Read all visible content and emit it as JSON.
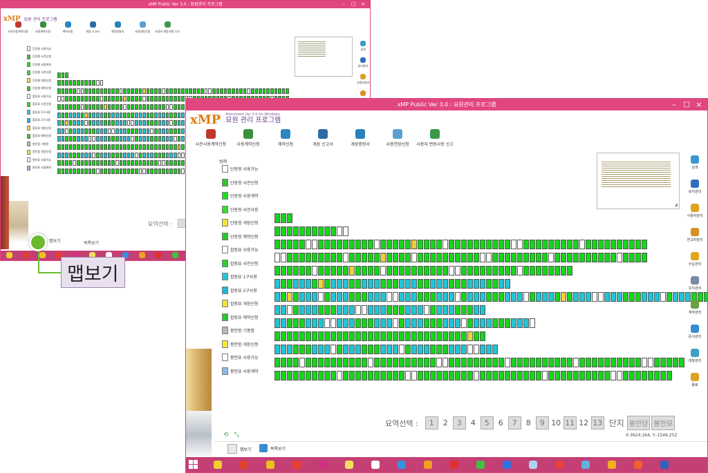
{
  "window": {
    "title": "xMP Public Ver 3.0 : 묘원관리 프로그램",
    "brand_mark": "xMP",
    "brand_tag": "Monument Ver 3.0 for Windows",
    "brand_sub": "묘원 관리 프로그램"
  },
  "toolbar": [
    {
      "label": "사전사용계약신청",
      "icon": "calendar-icon",
      "color": "#c0392b"
    },
    {
      "label": "사용계약신청",
      "icon": "contract-icon",
      "color": "#3a8f3a"
    },
    {
      "label": "해약신청",
      "icon": "cube-icon",
      "color": "#2e86c1"
    },
    {
      "label": "개장 신고서",
      "icon": "monitor-icon",
      "color": "#2e6da4"
    },
    {
      "label": "개장명령서",
      "icon": "book-icon",
      "color": "#2a80b9"
    },
    {
      "label": "사용연장신청",
      "icon": "papers-icon",
      "color": "#5aa0d0"
    },
    {
      "label": "사용자 변동사항 신고",
      "icon": "globe-icon",
      "color": "#3a9a4a"
    }
  ],
  "legend": {
    "title": "범례",
    "items": [
      {
        "label": "단장형 사용가능",
        "color": "#ffffff"
      },
      {
        "label": "단장형 사전신청",
        "color": "#34c334"
      },
      {
        "label": "단장형 사용계약",
        "color": "#19e019"
      },
      {
        "label": "단장형 사전사용",
        "color": "#33dd33"
      },
      {
        "label": "단장형 개장신청",
        "color": "#f5e33b"
      },
      {
        "label": "단장형 해약신청",
        "color": "#25cc25"
      },
      {
        "label": "합장묘 사용가능",
        "color": "#ffffff"
      },
      {
        "label": "합장묘 사전신청",
        "color": "#2fcf2f"
      },
      {
        "label": "합장묘 1구사용",
        "color": "#28c8d8"
      },
      {
        "label": "합장묘 2구사용",
        "color": "#1fbad0"
      },
      {
        "label": "합장묘 개장신청",
        "color": "#f0e040"
      },
      {
        "label": "합장묘 해약신청",
        "color": "#2ac82a"
      },
      {
        "label": "봉안함 기봉함",
        "color": "#b8b8b8"
      },
      {
        "label": "봉안함 개장신청",
        "color": "#f4e83c"
      },
      {
        "label": "봉안묘 사용가능",
        "color": "#ffffff"
      },
      {
        "label": "봉안묘 사용계약",
        "color": "#8fb8e8"
      }
    ]
  },
  "rows": [
    {
      "green": 0,
      "count": 0
    },
    {
      "count": 3,
      "pattern": "g"
    },
    {
      "count": 12,
      "pattern": "gw"
    },
    {
      "count": 60,
      "pattern": "gwy"
    },
    {
      "count": 60,
      "pattern": "gwy"
    },
    {
      "count": 48,
      "pattern": "gwy"
    },
    {
      "count": 38,
      "pattern": "gcy"
    },
    {
      "count": 72,
      "pattern": "gwcy"
    },
    {
      "count": 34,
      "pattern": "gcw"
    },
    {
      "count": 42,
      "pattern": "gcw"
    },
    {
      "count": 34,
      "pattern": "gy"
    },
    {
      "count": 36,
      "pattern": "gcw"
    },
    {
      "count": 66,
      "pattern": "gw"
    },
    {
      "count": 64,
      "pattern": "gw"
    }
  ],
  "year_selector": {
    "label": "묘역선택 :",
    "years": [
      "1",
      "2",
      "3",
      "4",
      "5",
      "6",
      "7",
      "8",
      "9",
      "10",
      "11",
      "12",
      "13"
    ],
    "boxed": [
      "1",
      "3",
      "5",
      "7",
      "9",
      "11",
      "13"
    ],
    "danji_label": "단지",
    "danji_buttons": [
      "봉안당",
      "봉안묘"
    ]
  },
  "coords": "X:3624.164, Y:-1546.252",
  "bottom_tabs": [
    {
      "label": "맵보기"
    },
    {
      "label": "목록보기"
    }
  ],
  "side_buttons": [
    {
      "label": "검색",
      "icon": "globe-search-icon",
      "color": "#3a9ad0"
    },
    {
      "label": "묘지관리",
      "icon": "map-icon",
      "color": "#2d6ec0"
    },
    {
      "label": "사용자관리",
      "icon": "person-icon",
      "color": "#e0a020"
    },
    {
      "label": "연고자관리",
      "icon": "group-icon",
      "color": "#d89020"
    },
    {
      "label": "수납관리",
      "icon": "coins-icon",
      "color": "#e2a418"
    },
    {
      "label": "유지관리",
      "icon": "tools-icon",
      "color": "#7a88a8"
    },
    {
      "label": "계약관리",
      "icon": "check-icon",
      "color": "#6aa040"
    },
    {
      "label": "문서관리",
      "icon": "document-icon",
      "color": "#3a8ad0"
    },
    {
      "label": "대장관리",
      "icon": "ledger-icon",
      "color": "#40a0c8"
    },
    {
      "label": "종료",
      "icon": "exit-icon",
      "color": "#e0a020"
    }
  ],
  "annotation": {
    "label": "맵보기"
  },
  "taskbar_icon_colors": [
    "#f0d030",
    "#e0402c",
    "#f0c020",
    "#e84030",
    "#d03080",
    "#f0e060",
    "#ffffff",
    "#3a90e0",
    "#f0a020",
    "#e03030",
    "#40c040",
    "#3070e0",
    "#b0d0f0",
    "#e84040",
    "#60b0e0",
    "#f0b020",
    "#f06030",
    "#3060c0"
  ]
}
